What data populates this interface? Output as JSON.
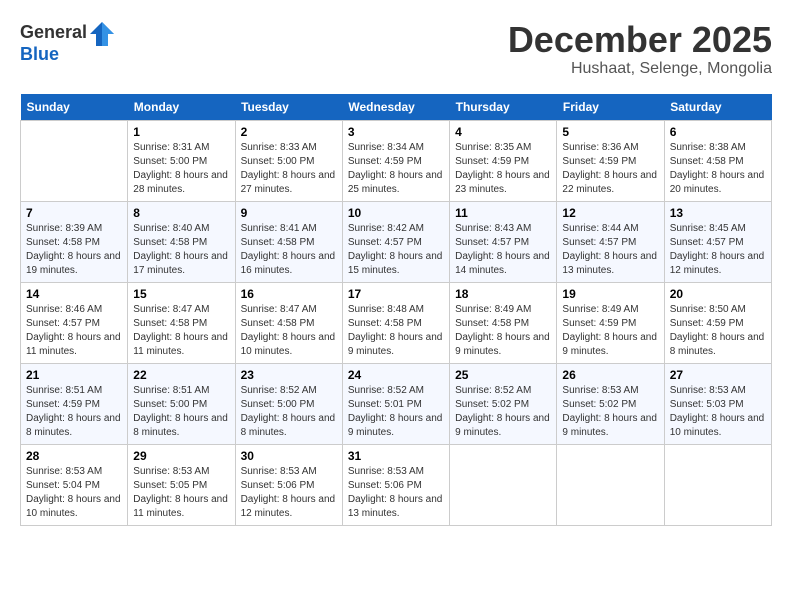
{
  "header": {
    "logo_line1": "General",
    "logo_line2": "Blue",
    "month_title": "December 2025",
    "location": "Hushaat, Selenge, Mongolia"
  },
  "weekdays": [
    "Sunday",
    "Monday",
    "Tuesday",
    "Wednesday",
    "Thursday",
    "Friday",
    "Saturday"
  ],
  "weeks": [
    [
      {
        "day": "",
        "sunrise": "",
        "sunset": "",
        "daylight": ""
      },
      {
        "day": "1",
        "sunrise": "8:31 AM",
        "sunset": "5:00 PM",
        "daylight": "8 hours and 28 minutes."
      },
      {
        "day": "2",
        "sunrise": "8:33 AM",
        "sunset": "5:00 PM",
        "daylight": "8 hours and 27 minutes."
      },
      {
        "day": "3",
        "sunrise": "8:34 AM",
        "sunset": "4:59 PM",
        "daylight": "8 hours and 25 minutes."
      },
      {
        "day": "4",
        "sunrise": "8:35 AM",
        "sunset": "4:59 PM",
        "daylight": "8 hours and 23 minutes."
      },
      {
        "day": "5",
        "sunrise": "8:36 AM",
        "sunset": "4:59 PM",
        "daylight": "8 hours and 22 minutes."
      },
      {
        "day": "6",
        "sunrise": "8:38 AM",
        "sunset": "4:58 PM",
        "daylight": "8 hours and 20 minutes."
      }
    ],
    [
      {
        "day": "7",
        "sunrise": "8:39 AM",
        "sunset": "4:58 PM",
        "daylight": "8 hours and 19 minutes."
      },
      {
        "day": "8",
        "sunrise": "8:40 AM",
        "sunset": "4:58 PM",
        "daylight": "8 hours and 17 minutes."
      },
      {
        "day": "9",
        "sunrise": "8:41 AM",
        "sunset": "4:58 PM",
        "daylight": "8 hours and 16 minutes."
      },
      {
        "day": "10",
        "sunrise": "8:42 AM",
        "sunset": "4:57 PM",
        "daylight": "8 hours and 15 minutes."
      },
      {
        "day": "11",
        "sunrise": "8:43 AM",
        "sunset": "4:57 PM",
        "daylight": "8 hours and 14 minutes."
      },
      {
        "day": "12",
        "sunrise": "8:44 AM",
        "sunset": "4:57 PM",
        "daylight": "8 hours and 13 minutes."
      },
      {
        "day": "13",
        "sunrise": "8:45 AM",
        "sunset": "4:57 PM",
        "daylight": "8 hours and 12 minutes."
      }
    ],
    [
      {
        "day": "14",
        "sunrise": "8:46 AM",
        "sunset": "4:57 PM",
        "daylight": "8 hours and 11 minutes."
      },
      {
        "day": "15",
        "sunrise": "8:47 AM",
        "sunset": "4:58 PM",
        "daylight": "8 hours and 11 minutes."
      },
      {
        "day": "16",
        "sunrise": "8:47 AM",
        "sunset": "4:58 PM",
        "daylight": "8 hours and 10 minutes."
      },
      {
        "day": "17",
        "sunrise": "8:48 AM",
        "sunset": "4:58 PM",
        "daylight": "8 hours and 9 minutes."
      },
      {
        "day": "18",
        "sunrise": "8:49 AM",
        "sunset": "4:58 PM",
        "daylight": "8 hours and 9 minutes."
      },
      {
        "day": "19",
        "sunrise": "8:49 AM",
        "sunset": "4:59 PM",
        "daylight": "8 hours and 9 minutes."
      },
      {
        "day": "20",
        "sunrise": "8:50 AM",
        "sunset": "4:59 PM",
        "daylight": "8 hours and 8 minutes."
      }
    ],
    [
      {
        "day": "21",
        "sunrise": "8:51 AM",
        "sunset": "4:59 PM",
        "daylight": "8 hours and 8 minutes."
      },
      {
        "day": "22",
        "sunrise": "8:51 AM",
        "sunset": "5:00 PM",
        "daylight": "8 hours and 8 minutes."
      },
      {
        "day": "23",
        "sunrise": "8:52 AM",
        "sunset": "5:00 PM",
        "daylight": "8 hours and 8 minutes."
      },
      {
        "day": "24",
        "sunrise": "8:52 AM",
        "sunset": "5:01 PM",
        "daylight": "8 hours and 9 minutes."
      },
      {
        "day": "25",
        "sunrise": "8:52 AM",
        "sunset": "5:02 PM",
        "daylight": "8 hours and 9 minutes."
      },
      {
        "day": "26",
        "sunrise": "8:53 AM",
        "sunset": "5:02 PM",
        "daylight": "8 hours and 9 minutes."
      },
      {
        "day": "27",
        "sunrise": "8:53 AM",
        "sunset": "5:03 PM",
        "daylight": "8 hours and 10 minutes."
      }
    ],
    [
      {
        "day": "28",
        "sunrise": "8:53 AM",
        "sunset": "5:04 PM",
        "daylight": "8 hours and 10 minutes."
      },
      {
        "day": "29",
        "sunrise": "8:53 AM",
        "sunset": "5:05 PM",
        "daylight": "8 hours and 11 minutes."
      },
      {
        "day": "30",
        "sunrise": "8:53 AM",
        "sunset": "5:06 PM",
        "daylight": "8 hours and 12 minutes."
      },
      {
        "day": "31",
        "sunrise": "8:53 AM",
        "sunset": "5:06 PM",
        "daylight": "8 hours and 13 minutes."
      },
      {
        "day": "",
        "sunrise": "",
        "sunset": "",
        "daylight": ""
      },
      {
        "day": "",
        "sunrise": "",
        "sunset": "",
        "daylight": ""
      },
      {
        "day": "",
        "sunrise": "",
        "sunset": "",
        "daylight": ""
      }
    ]
  ]
}
